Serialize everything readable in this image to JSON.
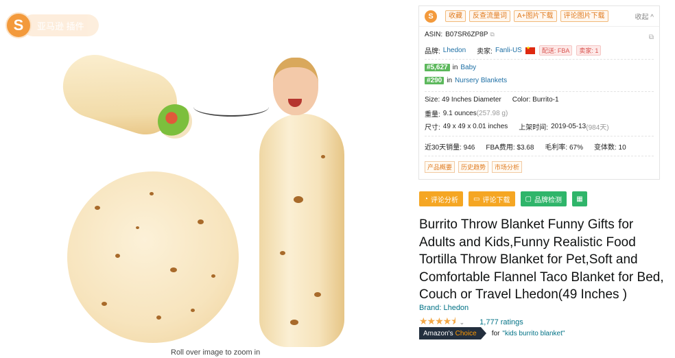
{
  "logo": {
    "letter": "S",
    "pill_text": "亚马逊 插件"
  },
  "image": {
    "zoom_hint": "Roll over image to zoom in"
  },
  "panel": {
    "toolbar": [
      "收藏",
      "反查流量词",
      "A+图片下载",
      "评论图片下载"
    ],
    "collapse_label": "收起 ^",
    "asin_label": "ASIN:",
    "asin": "B07SR6ZP8P",
    "brand_label": "品牌:",
    "brand": "Lhedon",
    "seller_label": "卖家:",
    "seller": "Fanli-US",
    "ship_label": "配送: FBA",
    "seller_count": "卖家: 1",
    "ranks": [
      {
        "rank": "#5,627",
        "in": "in",
        "category": "Baby"
      },
      {
        "rank": "#290",
        "in": "in",
        "category": "Nursery Blankets"
      }
    ],
    "size": "Size: 49 Inches Diameter",
    "color": "Color: Burrito-1",
    "weight_label": "重量:",
    "weight": "9.1 ounces",
    "weight_g": "(257.98 g)",
    "dims_label": "尺寸:",
    "dims": "49 x 49 x 0.01 inches",
    "listed_label": "上架时间:",
    "listed": "2019-05-13",
    "listed_days": "(984天)",
    "sales": "近30天销量: 946",
    "fba_fee": "FBA费用: $3.68",
    "margin": "毛利率: 67%",
    "variants": "变体数: 10",
    "tabs": [
      "产品概要",
      "历史趋势",
      "市场分析"
    ]
  },
  "actions": [
    {
      "label": "评论分析",
      "icon": "◔"
    },
    {
      "label": "评论下载",
      "icon": "▭"
    },
    {
      "label": "品牌检测",
      "icon": "▢"
    }
  ],
  "calc_icon": "▦",
  "product": {
    "title": "Burrito Throw Blanket Funny Gifts for Adults and Kids,Funny Realistic Food Tortilla Throw Blanket for Pet,Soft and Comfortable Flannel Taco Blanket for Bed, Couch or Travel Lhedon(49 Inches )",
    "brand_link": "Brand: Lhedon",
    "stars_display": "★★★★⯨",
    "chevron": "⌄",
    "ratings": "1,777 ratings",
    "choice_prefix": "Amazon's",
    "choice_word": "Choice",
    "for_text": "for",
    "keyword": "\"kids burrito blanket\""
  },
  "colors": {
    "accent": "#f39a3c",
    "link": "#007185",
    "orange_btn": "#f5a623",
    "green_btn": "#2fb56a"
  }
}
